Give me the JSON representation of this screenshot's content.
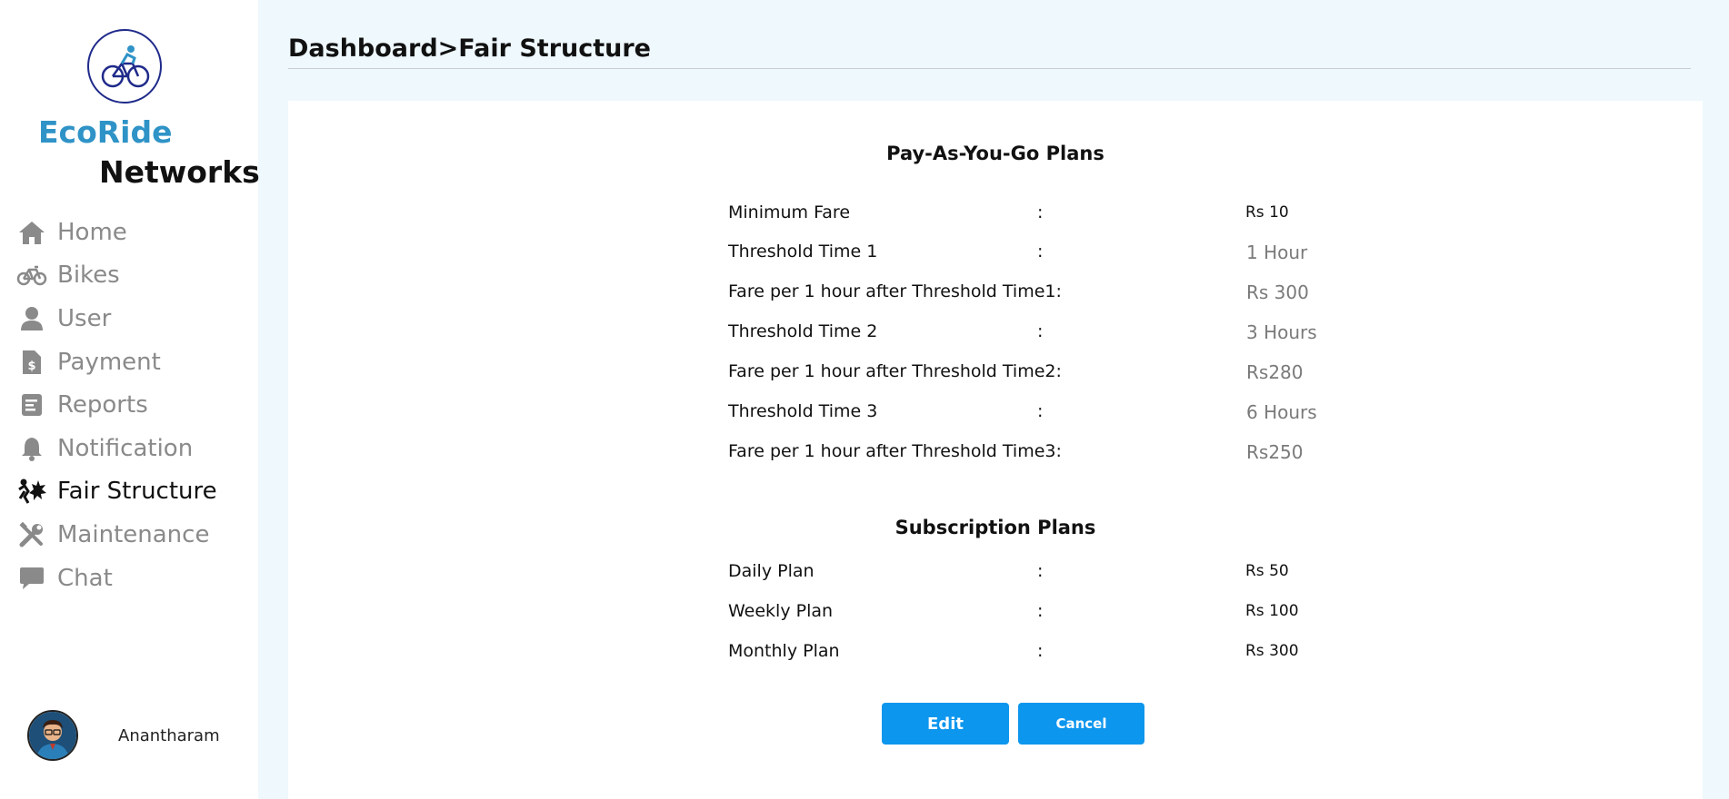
{
  "brand": {
    "line1": "EcoRide",
    "line2": "Networks"
  },
  "sidebar": {
    "items": [
      {
        "label": "Home",
        "icon": "home-icon"
      },
      {
        "label": "Bikes",
        "icon": "bicycle-icon"
      },
      {
        "label": "User",
        "icon": "user-icon"
      },
      {
        "label": "Payment",
        "icon": "invoice-dollar-icon"
      },
      {
        "label": "Reports",
        "icon": "report-icon"
      },
      {
        "label": "Notification",
        "icon": "bell-icon"
      },
      {
        "label": "Fair Structure",
        "icon": "fare-structure-icon",
        "active": true
      },
      {
        "label": "Maintenance",
        "icon": "tools-icon"
      },
      {
        "label": "Chat",
        "icon": "chat-icon"
      }
    ]
  },
  "user": {
    "name": "Anantharam"
  },
  "breadcrumb": "Dashboard>Fair Structure",
  "payg": {
    "title": "Pay-As-You-Go Plans",
    "rows": [
      {
        "label": "Minimum Fare",
        "colon": ":",
        "value": "Rs 10"
      },
      {
        "label": "Threshold Time 1",
        "colon": ":",
        "value": "1 Hour"
      },
      {
        "label": "Fare per 1 hour after Threshold Time1:",
        "colon": "",
        "value": "Rs 300"
      },
      {
        "label": "Threshold Time 2",
        "colon": ":",
        "value": "3 Hours"
      },
      {
        "label": "Fare per 1 hour after Threshold Time2:",
        "colon": "",
        "value": "Rs280"
      },
      {
        "label": "Threshold Time 3",
        "colon": ":",
        "value": "6 Hours"
      },
      {
        "label": "Fare per 1 hour after Threshold Time3:",
        "colon": "",
        "value": "Rs250"
      }
    ]
  },
  "subscription": {
    "title": "Subscription Plans",
    "rows": [
      {
        "label": "Daily Plan",
        "colon": ":",
        "value": "Rs 50"
      },
      {
        "label": "Weekly Plan",
        "colon": ":",
        "value": "Rs 100"
      },
      {
        "label": "Monthly Plan",
        "colon": ":",
        "value": "Rs 300"
      }
    ]
  },
  "buttons": {
    "edit": "Edit",
    "cancel": "Cancel"
  },
  "colors": {
    "accent": "#0d96ee",
    "brand": "#2f93c7",
    "background": "#eef8fd"
  }
}
